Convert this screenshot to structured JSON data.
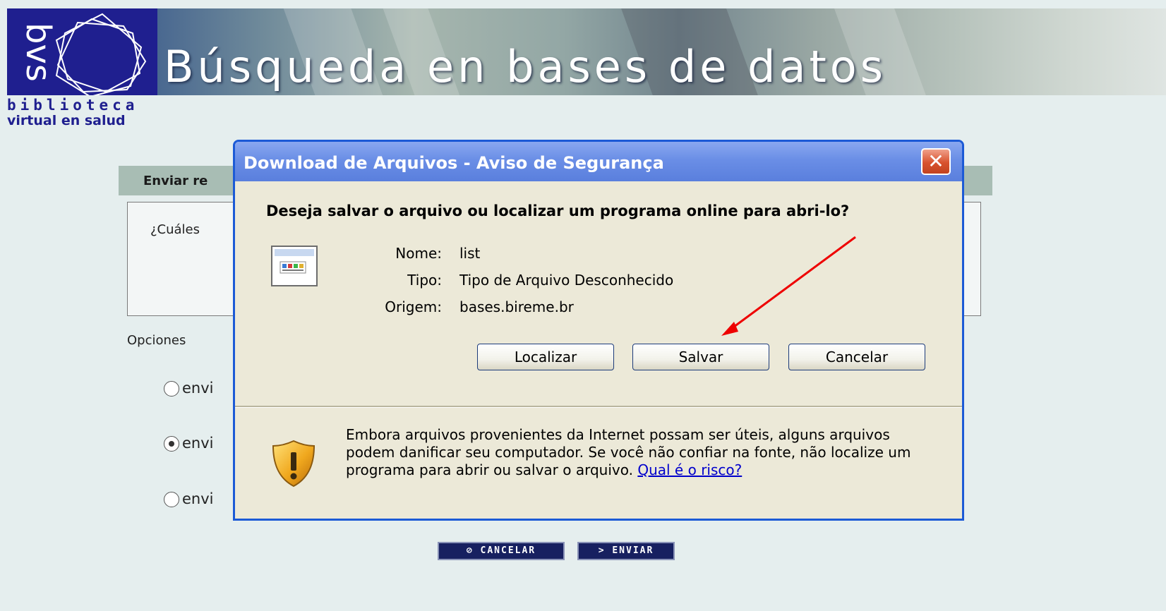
{
  "header": {
    "logo_text": "bvs",
    "title": "Búsqueda en bases de datos",
    "brand_line1": "biblioteca",
    "brand_line2": "virtual en salud"
  },
  "form": {
    "section_title": "Enviar re",
    "question": "¿Cuáles",
    "options_label": "Opciones",
    "radio_options": [
      {
        "label": "envi",
        "checked": false
      },
      {
        "label": "envi",
        "checked": true
      },
      {
        "label": "envi",
        "checked": false
      }
    ],
    "cancel_button": "⊘ CANCELAR",
    "send_button": "> ENVIAR"
  },
  "dialog": {
    "title": "Download de Arquivos - Aviso de Segurança",
    "close_icon": "close-icon",
    "question": "Deseja salvar o arquivo ou localizar um programa online para abri-lo?",
    "fields": {
      "name_label": "Nome:",
      "name_value": "list",
      "type_label": "Tipo:",
      "type_value": "Tipo de Arquivo Desconhecido",
      "origin_label": "Origem:",
      "origin_value": "bases.bireme.br"
    },
    "buttons": {
      "find": "Localizar",
      "save": "Salvar",
      "cancel": "Cancelar"
    },
    "warning": {
      "text": "Embora arquivos provenientes da Internet possam ser úteis, alguns arquivos podem danificar seu computador. Se você não confiar na fonte, não localize um programa para abrir ou salvar o arquivo.",
      "link": "Qual é o risco?"
    },
    "accent": "#1c5ad6",
    "background": "#ece9d8"
  },
  "annotation": {
    "arrow_color": "#ee0000"
  }
}
